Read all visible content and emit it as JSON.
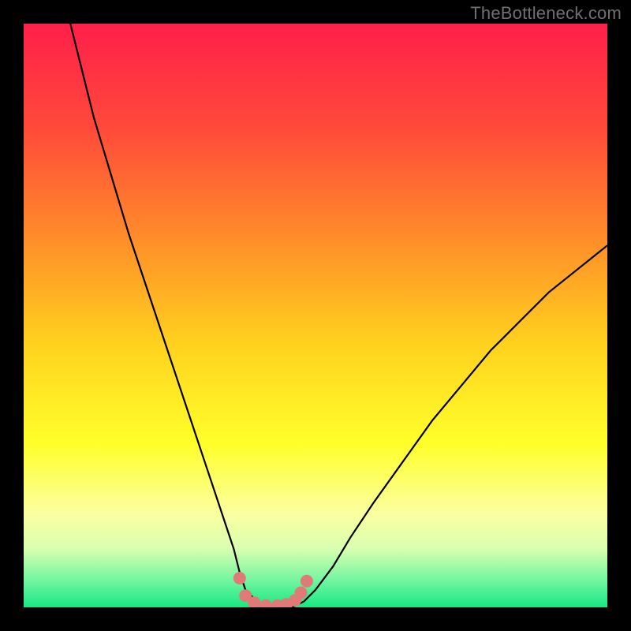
{
  "attribution": "TheBottleneck.com",
  "colors": {
    "frame": "#000000",
    "curve": "#000000",
    "marker": "#e07a77",
    "gradient_stops": [
      {
        "offset": 0.0,
        "color": "#ff1f4a"
      },
      {
        "offset": 0.18,
        "color": "#ff4a3a"
      },
      {
        "offset": 0.36,
        "color": "#ff8a2a"
      },
      {
        "offset": 0.55,
        "color": "#ffd21e"
      },
      {
        "offset": 0.72,
        "color": "#ffff2a"
      },
      {
        "offset": 0.84,
        "color": "#fbffa0"
      },
      {
        "offset": 0.9,
        "color": "#d8ffb0"
      },
      {
        "offset": 0.955,
        "color": "#70f5a0"
      },
      {
        "offset": 1.0,
        "color": "#17e880"
      }
    ]
  },
  "chart_data": {
    "type": "line",
    "title": "",
    "xlabel": "",
    "ylabel": "",
    "xlim": [
      0,
      100
    ],
    "ylim": [
      0,
      100
    ],
    "grid": false,
    "legend": false,
    "series": [
      {
        "name": "bottleneck-curve",
        "x": [
          8,
          10,
          12,
          15,
          18,
          21,
          24,
          27,
          30,
          32,
          34,
          36,
          37,
          38,
          40,
          42,
          44,
          46,
          48,
          50,
          53,
          56,
          60,
          65,
          70,
          75,
          80,
          85,
          90,
          95,
          100
        ],
        "values": [
          100,
          92,
          84,
          74,
          64,
          55,
          46,
          37,
          28,
          22,
          16,
          10,
          6,
          3,
          1,
          0,
          0,
          0,
          1,
          3,
          7,
          12,
          18,
          25,
          32,
          38,
          44,
          49,
          54,
          58,
          62
        ]
      }
    ],
    "markers": {
      "name": "highlighted-points",
      "x": [
        37.0,
        38.0,
        39.5,
        41.5,
        43.5,
        45.0,
        46.5,
        47.5,
        48.5
      ],
      "values": [
        5.0,
        2.0,
        0.8,
        0.3,
        0.3,
        0.5,
        1.2,
        2.5,
        4.5
      ]
    }
  }
}
